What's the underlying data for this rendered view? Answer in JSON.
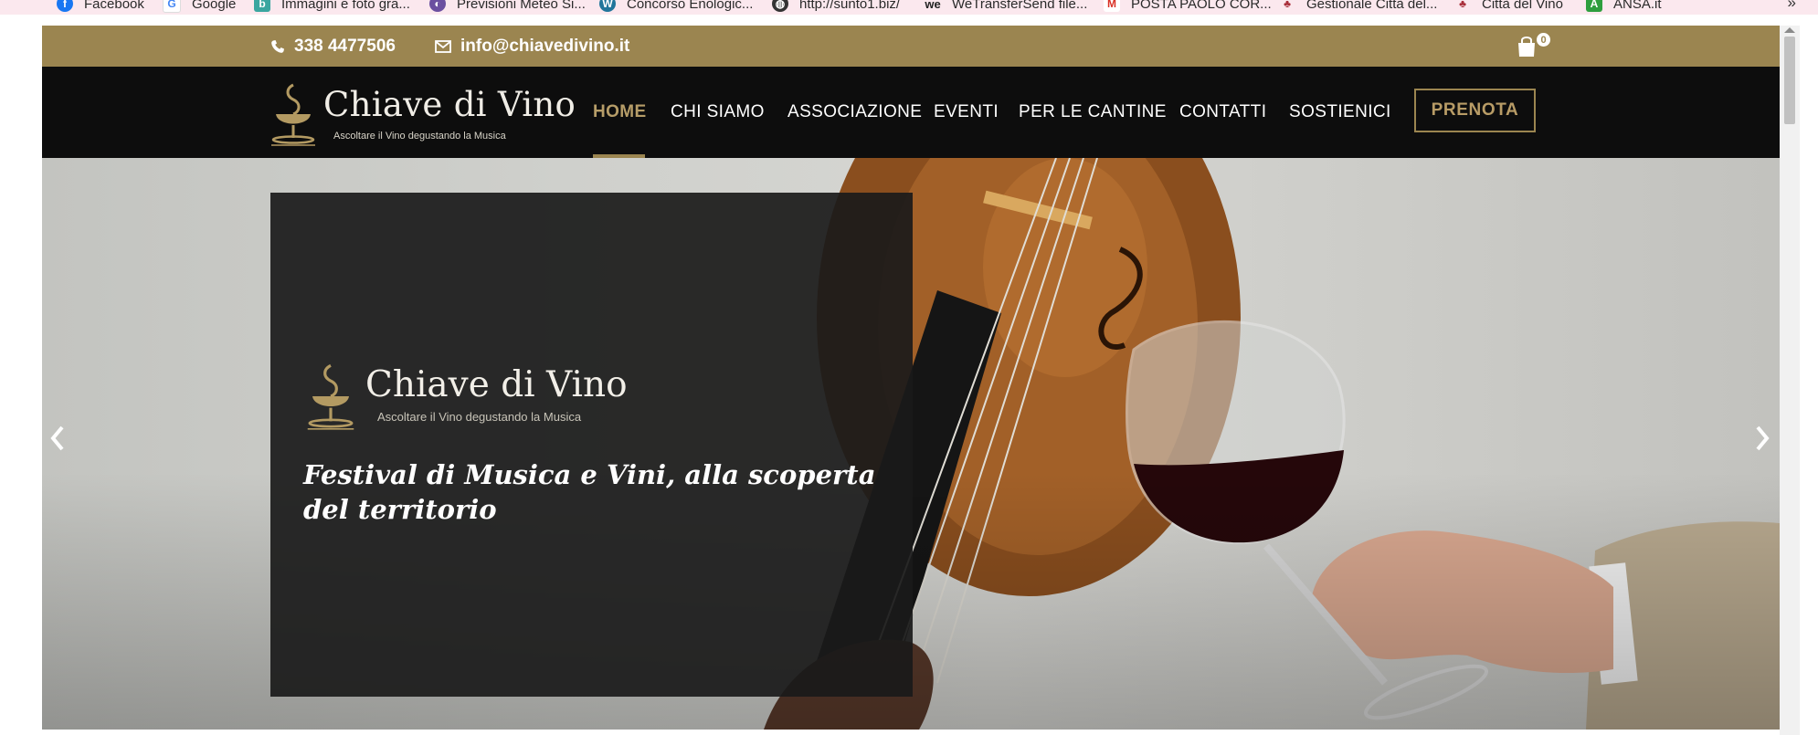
{
  "bookmarks": [
    {
      "label": "Facebook",
      "icon": "facebook-icon"
    },
    {
      "label": "Google",
      "icon": "google-icon"
    },
    {
      "label": "Immagini e foto gra...",
      "icon": "image-site-icon"
    },
    {
      "label": "Previsioni Meteo Si...",
      "icon": "weather-icon"
    },
    {
      "label": "Concorso Enologic...",
      "icon": "wordpress-icon"
    },
    {
      "label": "http://sunto1.biz/",
      "icon": "globe-icon"
    },
    {
      "label": "WeTransferSend file...",
      "icon": "wetransfer-icon"
    },
    {
      "label": "POSTA PAOLO COR...",
      "icon": "gmail-icon"
    },
    {
      "label": "Gestionale Città del...",
      "icon": "grape-icon"
    },
    {
      "label": "Città del Vino",
      "icon": "grape-icon"
    },
    {
      "label": "ANSA.it",
      "icon": "ansa-icon"
    }
  ],
  "bookmarks_more": "»",
  "topbar": {
    "phone": "338 4477506",
    "email": "info@chiavedivino.it",
    "cart_count": "0"
  },
  "brand": {
    "name": "Chiave di Vino",
    "tagline": "Ascoltare il Vino degustando la Musica"
  },
  "nav": {
    "items": [
      "HOME",
      "CHI SIAMO",
      "ASSOCIAZIONE",
      "EVENTI",
      "PER LE CANTINE",
      "CONTATTI",
      "SOSTIENICI"
    ],
    "active": "HOME",
    "cta": "PRENOTA"
  },
  "hero": {
    "logo_name": "Chiave di Vino",
    "logo_tagline": "Ascoltare il Vino degustando la Musica",
    "headline": "Festival di Musica e Vini, alla scoperta del territorio"
  },
  "colors": {
    "gold": "#9b8550",
    "dark": "#0d0d0d",
    "bookmark_bar": "#fbe8ee"
  }
}
